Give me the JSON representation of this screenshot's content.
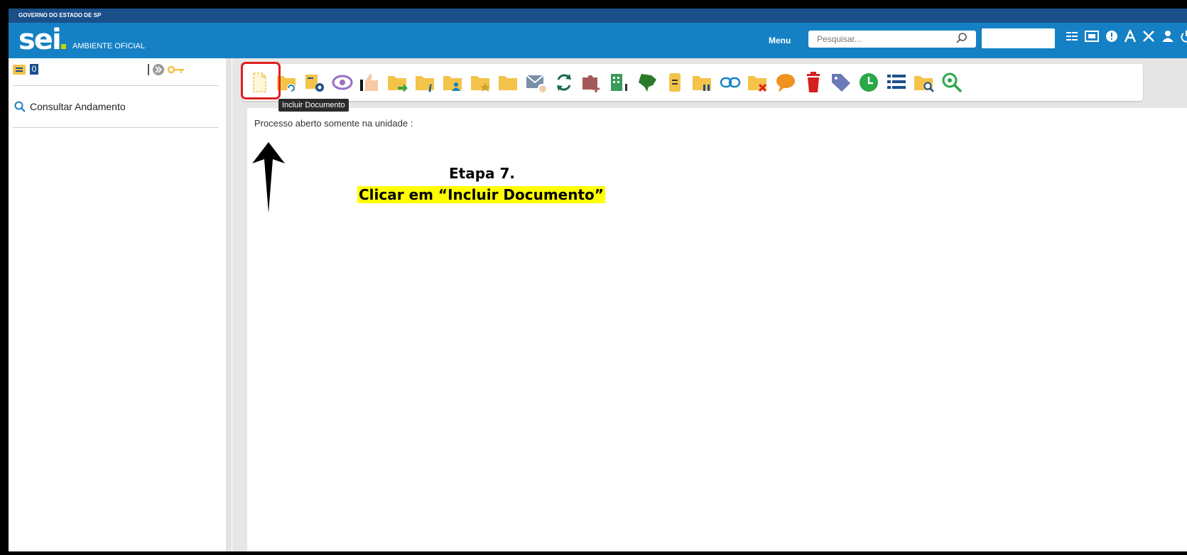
{
  "gov_bar": {
    "text": "GOVERNO DO ESTADO DE SP"
  },
  "header": {
    "logo": "sei",
    "environment": "AMBIENTE OFICIAL",
    "menu_label": "Menu",
    "search_placeholder": "Pesquisar...",
    "icons": [
      "list-icon",
      "calendar-123-icon",
      "info-icon",
      "font-icon",
      "tools-icon",
      "user-icon",
      "power-icon"
    ]
  },
  "sidebar": {
    "process_number_fragment": "0",
    "consult_label": "Consultar Andamento"
  },
  "toolbar": {
    "tooltip": "Incluir Documento",
    "icons": [
      "incluir-documento-icon",
      "iniciar-processo-relacionado-icon",
      "atualizar-andamento-icon",
      "acompanhamento-especial-icon",
      "ciencia-icon",
      "enviar-processo-icon",
      "informacoes-icon",
      "atribuir-processo-icon",
      "marcador-favorito-icon",
      "pasta-icon",
      "enviar-email-icon",
      "relacionamentos-icon",
      "anexar-processo-icon",
      "gerar-organograma-icon",
      "mapa-icon",
      "anotacoes-icon",
      "sobrestar-icon",
      "duplicar-processo-icon",
      "excluir-pasta-icon",
      "comentario-icon",
      "excluir-icon",
      "marcador-icon",
      "controle-prazo-icon",
      "lista-icon",
      "pesquisar-pasta-icon",
      "visualizar-icon"
    ]
  },
  "content": {
    "process_text": "Processo aberto somente na unidade :"
  },
  "annotation": {
    "step_title": "Etapa 7.",
    "step_instruction": "Clicar em “Incluir Documento”"
  },
  "colors": {
    "header": "#1581c4",
    "gov_bar": "#1b4f8a",
    "folder": "#f3c34a",
    "highlight": "#ffff00",
    "red_box": "#e02020"
  }
}
